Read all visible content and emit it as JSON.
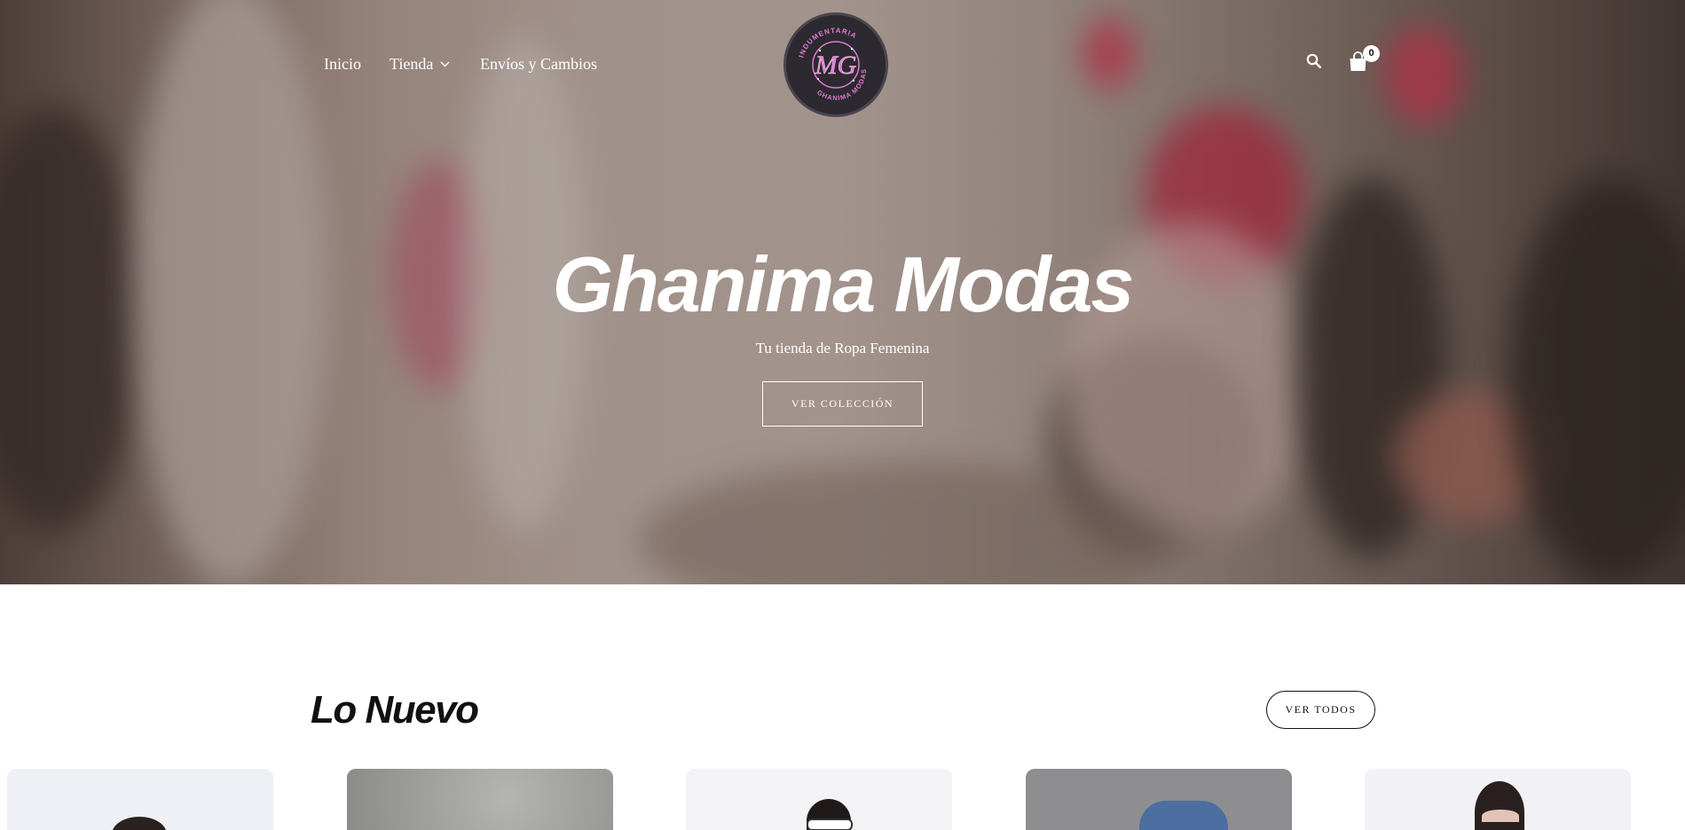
{
  "nav": {
    "items": [
      {
        "label": "Inicio"
      },
      {
        "label": "Tienda"
      },
      {
        "label": "Envíos y Cambios"
      }
    ],
    "cart_count": "0"
  },
  "logo": {
    "initials": "MG",
    "text_top": "INDUMENTARIA",
    "text_bottom": "GHANIMA MODAS"
  },
  "hero": {
    "title": "Ghanima Modas",
    "subtitle": "Tu tienda de Ropa Femenina",
    "button": "VER COLECCIÓN"
  },
  "new_section": {
    "title": "Lo Nuevo",
    "see_all": "VER TODOS"
  },
  "icons": {
    "search": "search-icon",
    "cart": "shopping-bag-icon",
    "dropdown": "chevron-down-icon"
  },
  "colors": {
    "logo_bg": "#2c2a30",
    "logo_accent": "#e07ad0",
    "text_dark": "#111111"
  }
}
